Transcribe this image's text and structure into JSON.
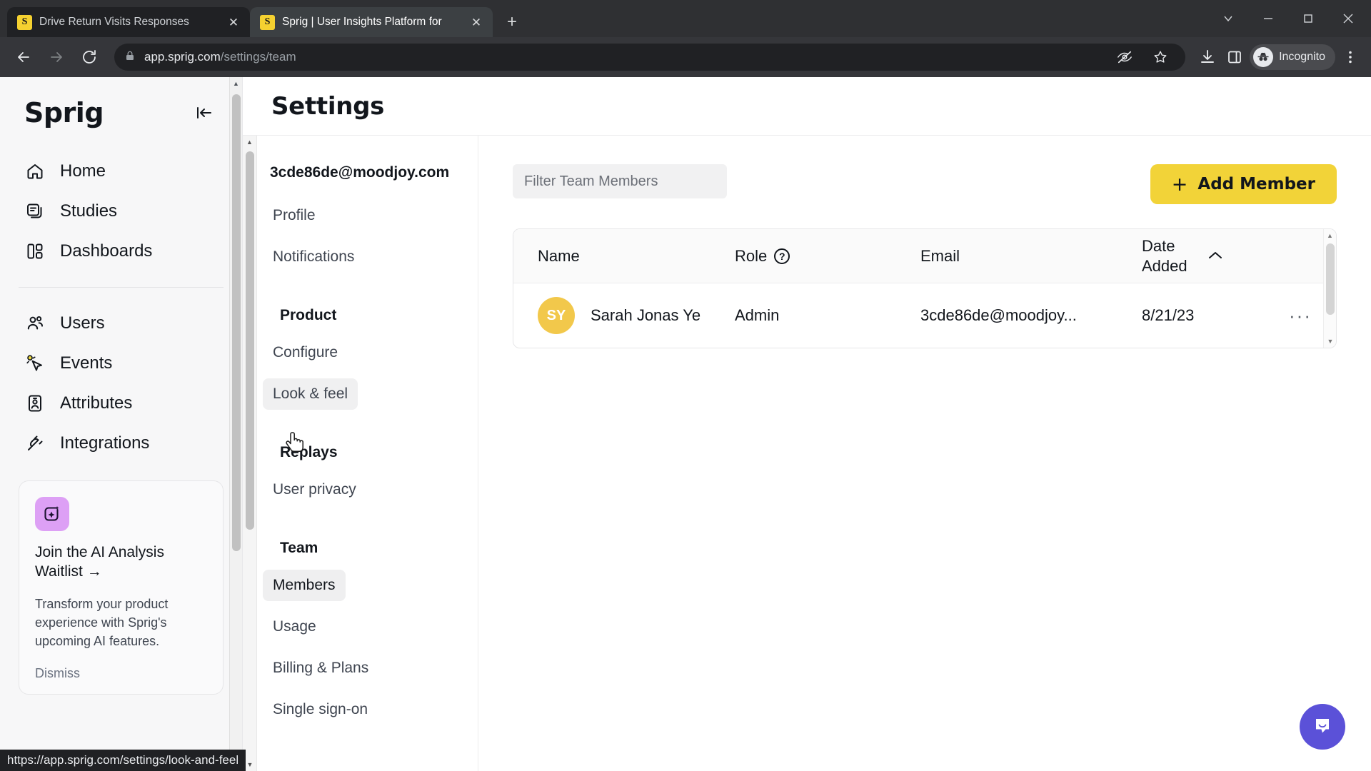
{
  "browser": {
    "tabs": [
      {
        "favicon": "S",
        "title": "Drive Return Visits Responses",
        "close": "✕",
        "active": false
      },
      {
        "favicon": "S",
        "title": "Sprig | User Insights Platform for",
        "close": "✕",
        "active": true
      }
    ],
    "new_tab_label": "+",
    "window_controls": {
      "list": "⌄",
      "minimize": "—",
      "maximize": "❐",
      "close": "✕"
    },
    "nav": {
      "back": "back-arrow",
      "forward": "forward-arrow",
      "reload": "reload"
    },
    "address": {
      "lock": "lock-icon",
      "domain": "app.sprig.com",
      "path": "/settings/team"
    },
    "profile_label": "Incognito",
    "status_link": "https://app.sprig.com/settings/look-and-feel"
  },
  "sidebar": {
    "brand": "Sprig",
    "collapse_icon": "collapse-sidebar-icon",
    "items": [
      {
        "label": "Home",
        "icon": "home-icon"
      },
      {
        "label": "Studies",
        "icon": "studies-icon"
      },
      {
        "label": "Dashboards",
        "icon": "dashboards-icon"
      },
      {
        "label": "Users",
        "icon": "users-icon"
      },
      {
        "label": "Events",
        "icon": "events-cursor-icon"
      },
      {
        "label": "Attributes",
        "icon": "attributes-badge-icon"
      },
      {
        "label": "Integrations",
        "icon": "integrations-plug-icon"
      }
    ],
    "promo": {
      "icon": "ai-sparkle-icon",
      "title": "Join the AI Analysis Waitlist →",
      "body": "Transform your product experience with Sprig's upcoming AI features.",
      "dismiss": "Dismiss"
    }
  },
  "header": {
    "title": "Settings"
  },
  "settings_nav": {
    "account_email": "3cde86de@moodjoy.com",
    "items": [
      {
        "label": "Profile",
        "type": "item",
        "state": "normal"
      },
      {
        "label": "Notifications",
        "type": "item",
        "state": "normal"
      },
      {
        "label": "Product",
        "type": "group"
      },
      {
        "label": "Configure",
        "type": "item",
        "state": "normal"
      },
      {
        "label": "Look & feel",
        "type": "item",
        "state": "hover"
      },
      {
        "label": "Replays",
        "type": "group"
      },
      {
        "label": "User privacy",
        "type": "item",
        "state": "normal"
      },
      {
        "label": "Team",
        "type": "group"
      },
      {
        "label": "Members",
        "type": "item",
        "state": "active"
      },
      {
        "label": "Usage",
        "type": "item",
        "state": "normal"
      },
      {
        "label": "Billing & Plans",
        "type": "item",
        "state": "normal"
      },
      {
        "label": "Single sign-on",
        "type": "item",
        "state": "normal"
      }
    ]
  },
  "team": {
    "filter_placeholder": "Filter Team Members",
    "filter_value": "",
    "add_button": {
      "plus": "+",
      "label": "Add Member"
    },
    "columns": {
      "name": "Name",
      "role": "Role",
      "role_help": "?",
      "email": "Email",
      "date_added_line1": "Date",
      "date_added_line2": "Added",
      "sort_icon": "⌃"
    },
    "rows": [
      {
        "initials": "SY",
        "name": "Sarah Jonas Ye",
        "role": "Admin",
        "email": "3cde86de@moodjoy...",
        "date_added": "8/21/23",
        "menu": "···"
      }
    ]
  },
  "chat": {
    "icon": "intercom-chat-icon"
  },
  "colors": {
    "brand_yellow": "#F2D338",
    "avatar_yellow": "#F2C84B",
    "promo_purple": "#DDA0F5",
    "chat_purple": "#5B51D8"
  }
}
